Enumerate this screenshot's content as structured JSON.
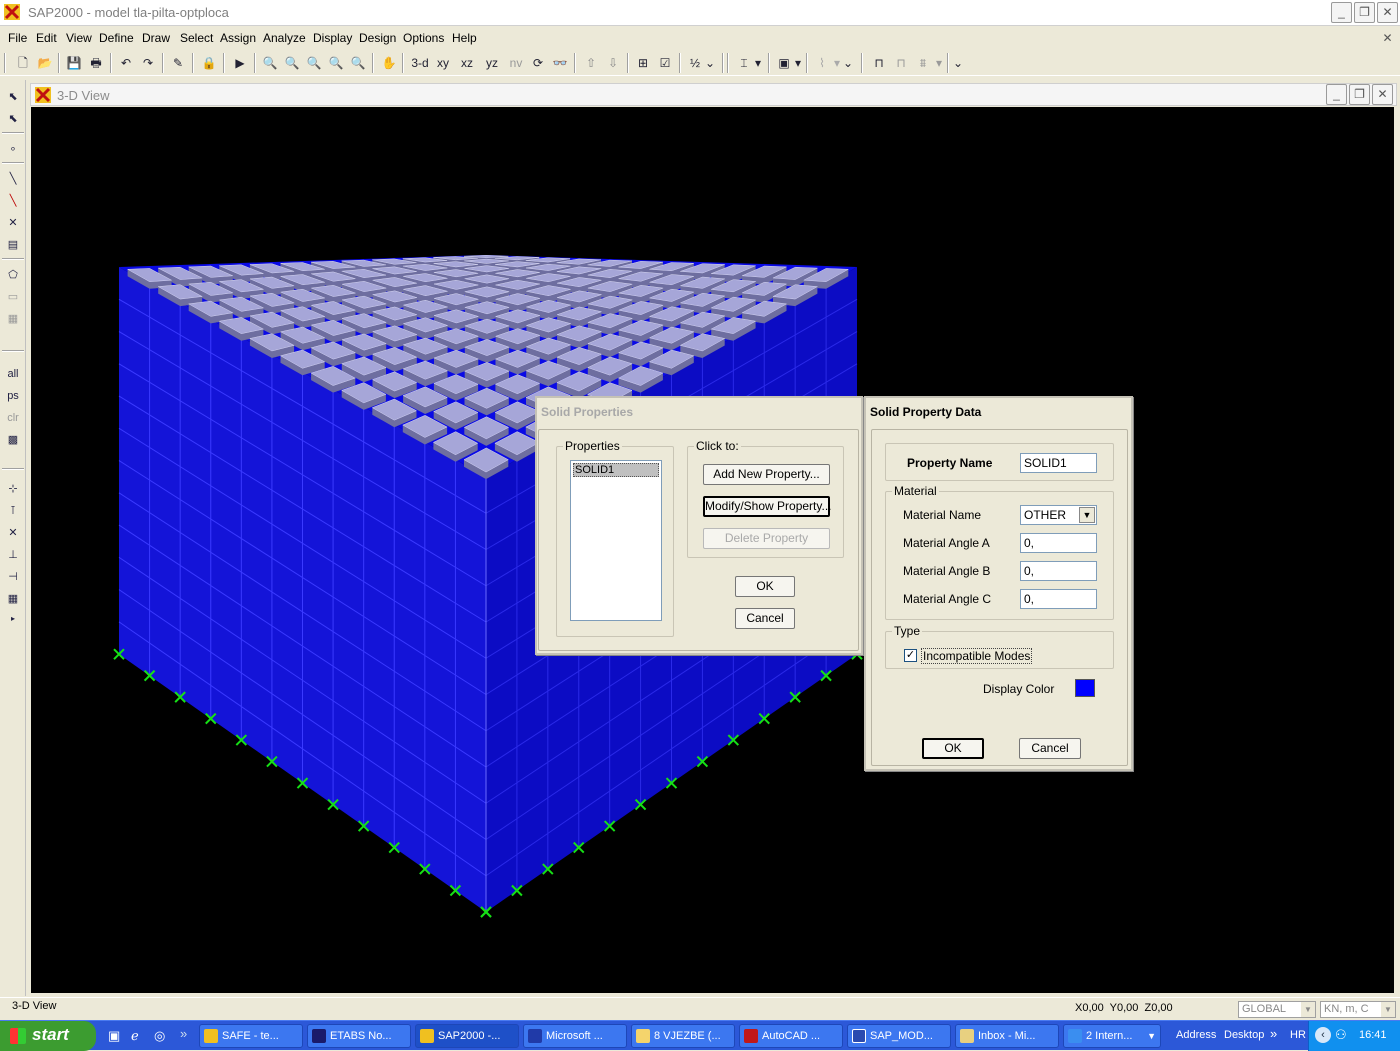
{
  "app": {
    "title": "SAP2000 - model tla-pilta-optploca",
    "minimize": "_",
    "restore": "❐",
    "close": "✕"
  },
  "menu": [
    "File",
    "Edit",
    "View",
    "Define",
    "Draw",
    "Select",
    "Assign",
    "Analyze",
    "Display",
    "Design",
    "Options",
    "Help"
  ],
  "toolbar": {
    "view_3d": "3-d",
    "view_xy": "xy",
    "view_xz": "xz",
    "view_yz": "yz",
    "view_nv": "nv"
  },
  "left_toolbar": {
    "select_all": "all",
    "select_ps": "ps",
    "select_clr": "clr"
  },
  "view_window": {
    "title": "3-D View",
    "minimize": "_",
    "restore": "❐",
    "close": "✕",
    "background": "#000000",
    "solid_color": "#0a0ae6",
    "pile_cap_color": "#a6a6d8",
    "support_color": "#16e016"
  },
  "solid_properties": {
    "title": "Solid Properties",
    "properties_label": "Properties",
    "items": [
      "SOLID1"
    ],
    "click_to_label": "Click to:",
    "add_button": "Add New Property...",
    "modify_button": "Modify/Show Property...",
    "delete_button": "Delete Property",
    "ok_button": "OK",
    "cancel_button": "Cancel"
  },
  "solid_property_data": {
    "title": "Solid Property Data",
    "property_name_label": "Property Name",
    "property_name_value": "SOLID1",
    "material_group": "Material",
    "material_name_label": "Material Name",
    "material_name_value": "OTHER",
    "angle_a_label": "Material Angle A",
    "angle_a_value": "0,",
    "angle_b_label": "Material Angle B",
    "angle_b_value": "0,",
    "angle_c_label": "Material Angle C",
    "angle_c_value": "0,",
    "type_group": "Type",
    "incompatible_label": "Incompatible Modes",
    "incompatible_checked": true,
    "display_color_label": "Display Color",
    "display_color": "#0000ff",
    "ok_button": "OK",
    "cancel_button": "Cancel"
  },
  "status": {
    "view": "3-D View",
    "coords": "X0,00  Y0,00  Z0,00",
    "coord_system": "GLOBAL",
    "units": "KN, m, C"
  },
  "taskbar": {
    "start": "start",
    "tasks": [
      "SAFE - te...",
      "ETABS No...",
      "SAP2000 -...",
      "Microsoft ...",
      "8 VJEZBE (...",
      "AutoCAD ...",
      "SAP_MOD...",
      "Inbox - Mi...",
      "2 Intern..."
    ],
    "address": "Address",
    "desktop": "Desktop",
    "lang": "HR",
    "time": "16:41"
  }
}
